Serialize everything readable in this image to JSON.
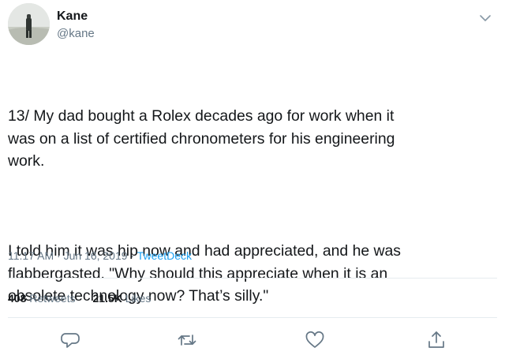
{
  "tweet": {
    "author": {
      "name": "Kane",
      "handle": "@kane",
      "avatar_icon": "avatar-photo"
    },
    "menu_icon": "chevron-down-icon",
    "text": {
      "paragraph1": "13/ My dad bought a Rolex decades ago for work when it\nwas on a list of certified chronometers for his engineering\nwork.",
      "paragraph2": "I told him it was hip now and had appreciated, and he was\nflabbergasted. \"Why should this appreciate when it is an\nobsolete technology now? That’s silly.\""
    },
    "meta": {
      "time": "11:17 AM",
      "separator1": " · ",
      "date": "Jun 16, 2019",
      "separator2": " · ",
      "source": "TweetDeck"
    },
    "stats": {
      "retweets_count": "408",
      "retweets_label": "Retweets",
      "likes_count": "21.5K",
      "likes_label": "Likes"
    },
    "actions": [
      {
        "name": "reply",
        "icon": "reply-icon"
      },
      {
        "name": "retweet",
        "icon": "retweet-icon"
      },
      {
        "name": "like",
        "icon": "heart-icon"
      },
      {
        "name": "share",
        "icon": "share-icon"
      }
    ]
  },
  "colors": {
    "text_primary": "#14171a",
    "text_secondary": "#657786",
    "link": "#1da1f2",
    "divider": "#e6ecf0"
  }
}
